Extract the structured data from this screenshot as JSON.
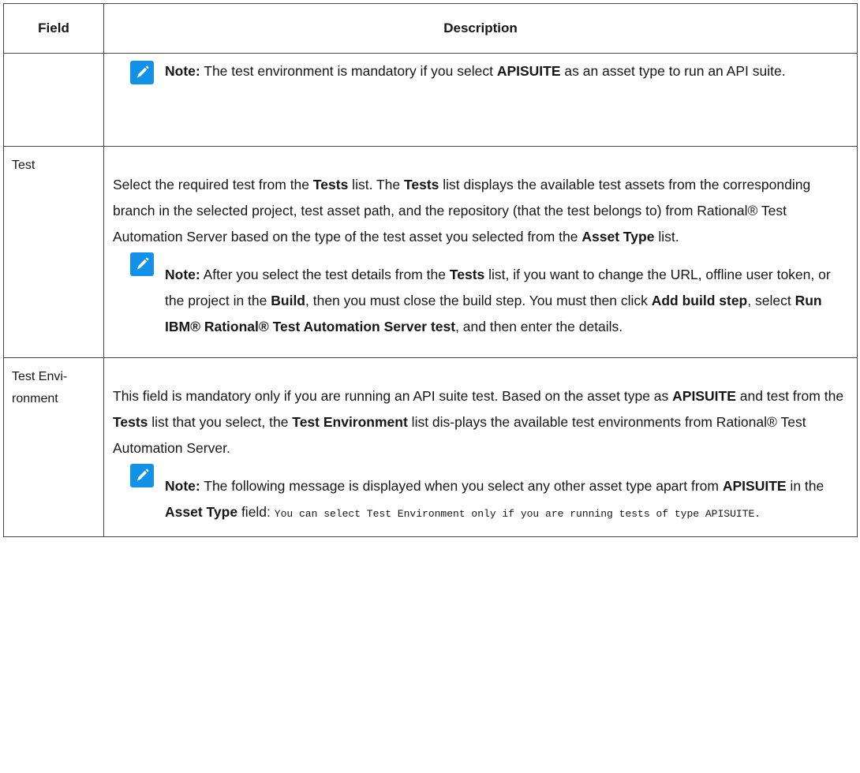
{
  "table": {
    "header": {
      "field": "Field",
      "description": "Description"
    },
    "rows": [
      {
        "field": "",
        "note": {
          "label": "Note:",
          "parts": [
            {
              "t": " The test environment is mandatory if you select "
            },
            {
              "b": "APISUITE"
            },
            {
              "t": " as an asset type to run an API suite."
            }
          ]
        }
      },
      {
        "field": "Test",
        "paragraph": [
          {
            "t": "Select the required test from the "
          },
          {
            "b": "Tests"
          },
          {
            "t": " list. The "
          },
          {
            "b": "Tests"
          },
          {
            "t": " list displays the available test assets from the corresponding branch in the selected project, test asset path, and the repository (that the test belongs to) from Rational® Test Automation Server based on the type of the test asset you selected from the "
          },
          {
            "b": "Asset Type"
          },
          {
            "t": " list."
          }
        ],
        "note": {
          "label": "Note:",
          "parts": [
            {
              "t": " After you select the test details from the "
            },
            {
              "b": "Tests"
            },
            {
              "t": " list, if you want to change the URL, offline user token, or the project in the "
            },
            {
              "b": "Build"
            },
            {
              "t": ", then you must close the build step. You must then click "
            },
            {
              "b": "Add build step"
            },
            {
              "t": ", select "
            },
            {
              "b": "Run IBM® Rational® Test Automation Server test"
            },
            {
              "t": ", and then enter the details."
            }
          ]
        }
      },
      {
        "field": "Test Envi-ronment",
        "paragraph": [
          {
            "t": "This field is mandatory only if you are running an API suite test. Based on the asset type as "
          },
          {
            "b": "APISUITE"
          },
          {
            "t": " and test from the "
          },
          {
            "b": "Tests"
          },
          {
            "t": " list that you select, the "
          },
          {
            "b": "Test Environment"
          },
          {
            "t": " list dis-plays the available test environments from Rational® Test Automation Server."
          }
        ],
        "note": {
          "label": "Note:",
          "parts": [
            {
              "t": " The following message is displayed when you select any other asset type apart from "
            },
            {
              "b": "APISUITE"
            },
            {
              "t": " in the "
            },
            {
              "b": "Asset Type"
            },
            {
              "t": " field: "
            },
            {
              "c": "You can select Test Environment only if you are running tests of type APISUITE."
            }
          ]
        }
      }
    ]
  },
  "icons": {
    "note": "pencil-note-icon"
  },
  "colors": {
    "note_icon_bg": "#1192e8",
    "border": "#444444",
    "text": "#161616"
  }
}
